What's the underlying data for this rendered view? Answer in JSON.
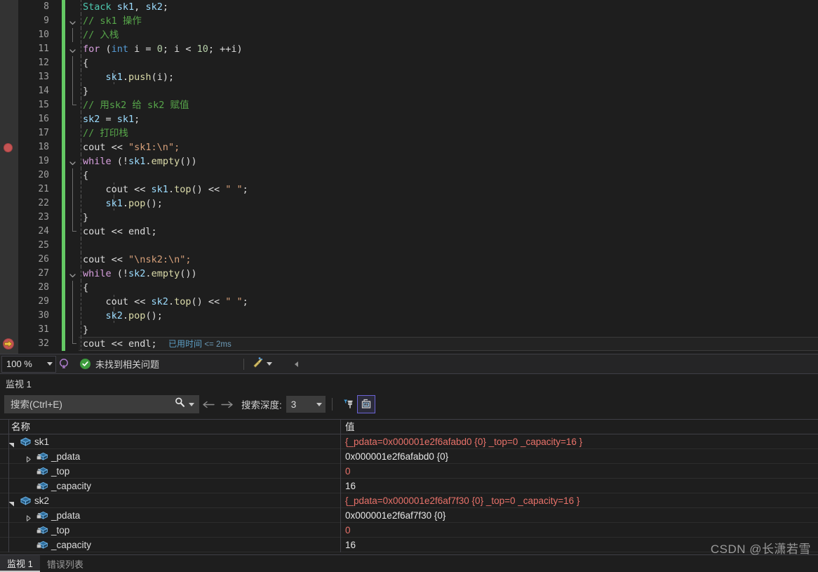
{
  "editor": {
    "lines": [
      {
        "no": "8",
        "indent": 0,
        "change": true,
        "outline": "none",
        "guides": [
          1
        ],
        "tokens": [
          {
            "t": "Stack",
            "c": "cls"
          },
          {
            "t": " ",
            "c": "pun"
          },
          {
            "t": "sk1",
            "c": "var"
          },
          {
            "t": ", ",
            "c": "pun"
          },
          {
            "t": "sk2",
            "c": "var"
          },
          {
            "t": ";",
            "c": "pun"
          }
        ]
      },
      {
        "no": "9",
        "indent": 0,
        "change": true,
        "outline": "chevron",
        "guides": [
          1
        ],
        "tokens": [
          {
            "t": "// sk1 操作",
            "c": "cmt"
          }
        ]
      },
      {
        "no": "10",
        "indent": 0,
        "change": true,
        "outline": "line",
        "guides": [
          1
        ],
        "tokens": [
          {
            "t": "// 入栈",
            "c": "cmt"
          }
        ]
      },
      {
        "no": "11",
        "indent": 0,
        "change": true,
        "outline": "chevron",
        "guides": [
          1
        ],
        "tokens": [
          {
            "t": "for",
            "c": "kw"
          },
          {
            "t": " (",
            "c": "pun"
          },
          {
            "t": "int",
            "c": "type"
          },
          {
            "t": " i = ",
            "c": "pun"
          },
          {
            "t": "0",
            "c": "num"
          },
          {
            "t": "; i < ",
            "c": "pun"
          },
          {
            "t": "10",
            "c": "num"
          },
          {
            "t": "; ++i)",
            "c": "pun"
          }
        ]
      },
      {
        "no": "12",
        "indent": 0,
        "change": true,
        "outline": "line",
        "guides": [
          1
        ],
        "tokens": [
          {
            "t": "{",
            "c": "pun"
          }
        ]
      },
      {
        "no": "13",
        "indent": 0,
        "change": true,
        "outline": "line",
        "guides": [
          1,
          2
        ],
        "tokens": [
          {
            "t": "    sk1",
            "c": "var"
          },
          {
            "t": ".",
            "c": "pun"
          },
          {
            "t": "push",
            "c": "fn"
          },
          {
            "t": "(i);",
            "c": "pun"
          }
        ]
      },
      {
        "no": "14",
        "indent": 0,
        "change": true,
        "outline": "line",
        "guides": [
          1
        ],
        "tokens": [
          {
            "t": "}",
            "c": "pun"
          }
        ]
      },
      {
        "no": "15",
        "indent": 0,
        "change": true,
        "outline": "foot",
        "guides": [
          1
        ],
        "tokens": [
          {
            "t": "// 用sk2 给 sk2 赋值",
            "c": "cmt"
          }
        ]
      },
      {
        "no": "16",
        "indent": 0,
        "change": true,
        "outline": "none",
        "guides": [
          1
        ],
        "tokens": [
          {
            "t": "sk2",
            "c": "var"
          },
          {
            "t": " = ",
            "c": "pun"
          },
          {
            "t": "sk1",
            "c": "var"
          },
          {
            "t": ";",
            "c": "pun"
          }
        ]
      },
      {
        "no": "17",
        "indent": 0,
        "change": true,
        "outline": "none",
        "guides": [
          1
        ],
        "tokens": [
          {
            "t": "// 打印栈",
            "c": "cmt"
          }
        ]
      },
      {
        "no": "18",
        "indent": 0,
        "change": true,
        "outline": "none",
        "guides": [
          1
        ],
        "breakpoint": true,
        "tokens": [
          {
            "t": "cout",
            "c": "pun"
          },
          {
            "t": " << ",
            "c": "pun"
          },
          {
            "t": "\"sk1:",
            "c": "str"
          },
          {
            "t": "\\n",
            "c": "str"
          },
          {
            "t": "\";",
            "c": "str"
          }
        ]
      },
      {
        "no": "19",
        "indent": 0,
        "change": true,
        "outline": "chevron",
        "guides": [
          1
        ],
        "tokens": [
          {
            "t": "while",
            "c": "kw"
          },
          {
            "t": " (!",
            "c": "pun"
          },
          {
            "t": "sk1",
            "c": "var"
          },
          {
            "t": ".",
            "c": "pun"
          },
          {
            "t": "empty",
            "c": "fn"
          },
          {
            "t": "())",
            "c": "pun"
          }
        ]
      },
      {
        "no": "20",
        "indent": 0,
        "change": true,
        "outline": "line",
        "guides": [
          1
        ],
        "tokens": [
          {
            "t": "{",
            "c": "pun"
          }
        ]
      },
      {
        "no": "21",
        "indent": 0,
        "change": true,
        "outline": "line",
        "guides": [
          1,
          2
        ],
        "tokens": [
          {
            "t": "    cout << ",
            "c": "pun"
          },
          {
            "t": "sk1",
            "c": "var"
          },
          {
            "t": ".",
            "c": "pun"
          },
          {
            "t": "top",
            "c": "fn"
          },
          {
            "t": "() << ",
            "c": "pun"
          },
          {
            "t": "\" \"",
            "c": "str"
          },
          {
            "t": ";",
            "c": "pun"
          }
        ]
      },
      {
        "no": "22",
        "indent": 0,
        "change": true,
        "outline": "line",
        "guides": [
          1,
          2
        ],
        "tokens": [
          {
            "t": "    sk1",
            "c": "var"
          },
          {
            "t": ".",
            "c": "pun"
          },
          {
            "t": "pop",
            "c": "fn"
          },
          {
            "t": "();",
            "c": "pun"
          }
        ]
      },
      {
        "no": "23",
        "indent": 0,
        "change": true,
        "outline": "line",
        "guides": [
          1
        ],
        "tokens": [
          {
            "t": "}",
            "c": "pun"
          }
        ]
      },
      {
        "no": "24",
        "indent": 0,
        "change": true,
        "outline": "foot",
        "guides": [
          1
        ],
        "tokens": [
          {
            "t": "cout << ",
            "c": "pun"
          },
          {
            "t": "endl",
            "c": "pun"
          },
          {
            "t": ";",
            "c": "pun"
          }
        ]
      },
      {
        "no": "25",
        "indent": 0,
        "change": true,
        "outline": "none",
        "guides": [
          1
        ],
        "tokens": []
      },
      {
        "no": "26",
        "indent": 0,
        "change": true,
        "outline": "none",
        "guides": [
          1
        ],
        "tokens": [
          {
            "t": "cout << ",
            "c": "pun"
          },
          {
            "t": "\"",
            "c": "str"
          },
          {
            "t": "\\n",
            "c": "str"
          },
          {
            "t": "sk2:",
            "c": "str"
          },
          {
            "t": "\\n",
            "c": "str"
          },
          {
            "t": "\";",
            "c": "str"
          }
        ]
      },
      {
        "no": "27",
        "indent": 0,
        "change": true,
        "outline": "chevron",
        "guides": [
          1
        ],
        "tokens": [
          {
            "t": "while",
            "c": "kw"
          },
          {
            "t": " (!",
            "c": "pun"
          },
          {
            "t": "sk2",
            "c": "var"
          },
          {
            "t": ".",
            "c": "pun"
          },
          {
            "t": "empty",
            "c": "fn"
          },
          {
            "t": "())",
            "c": "pun"
          }
        ]
      },
      {
        "no": "28",
        "indent": 0,
        "change": true,
        "outline": "line",
        "guides": [
          1
        ],
        "tokens": [
          {
            "t": "{",
            "c": "pun"
          }
        ]
      },
      {
        "no": "29",
        "indent": 0,
        "change": true,
        "outline": "line",
        "guides": [
          1,
          2
        ],
        "tokens": [
          {
            "t": "    cout << ",
            "c": "pun"
          },
          {
            "t": "sk2",
            "c": "var"
          },
          {
            "t": ".",
            "c": "pun"
          },
          {
            "t": "top",
            "c": "fn"
          },
          {
            "t": "() << ",
            "c": "pun"
          },
          {
            "t": "\" \"",
            "c": "str"
          },
          {
            "t": ";",
            "c": "pun"
          }
        ]
      },
      {
        "no": "30",
        "indent": 0,
        "change": true,
        "outline": "line",
        "guides": [
          1,
          2
        ],
        "tokens": [
          {
            "t": "    sk2",
            "c": "var"
          },
          {
            "t": ".",
            "c": "pun"
          },
          {
            "t": "pop",
            "c": "fn"
          },
          {
            "t": "();",
            "c": "pun"
          }
        ]
      },
      {
        "no": "31",
        "indent": 0,
        "change": true,
        "outline": "line",
        "guides": [
          1
        ],
        "tokens": [
          {
            "t": "}",
            "c": "pun"
          }
        ]
      },
      {
        "no": "32",
        "indent": 0,
        "change": true,
        "outline": "foot",
        "guides": [
          1
        ],
        "current": true,
        "tokens": [
          {
            "t": "cout << ",
            "c": "pun"
          },
          {
            "t": "endl",
            "c": "pun"
          },
          {
            "t": ";",
            "c": "pun"
          }
        ],
        "elapsed_label": "已用时间",
        "elapsed_value": "<= 2ms"
      }
    ]
  },
  "editor_status": {
    "zoom": "100 %",
    "zoom_caret": "chevron-down-icon",
    "pin_icon": "feedback-icon",
    "ok_mark": "✓",
    "message": "未找到相关问题",
    "brush_icon": "brush-icon",
    "brush_caret": "chevron-down-icon",
    "collapse_icon": "left-triangle-icon"
  },
  "watch": {
    "title": "监视 1",
    "search": {
      "placeholder": "搜索(Ctrl+E)",
      "value": "",
      "icon": "search-icon",
      "caret": "chevron-down-icon"
    },
    "nav_back": "←",
    "nav_forward": "→",
    "depth_label": "搜索深度:",
    "depth_value": "3",
    "depth_caret": "chevron-down-icon",
    "pin_button": "filter-pin-icon",
    "hex_button": "hex-display-icon",
    "columns": {
      "name": "名称",
      "value": "值"
    },
    "rows": [
      {
        "indent": 0,
        "twisty": "expanded",
        "icon": "object-icon",
        "name": "sk1",
        "value": "{_pdata=0x000001e2f6afabd0 {0} _top=0 _capacity=16 }",
        "changed": true
      },
      {
        "indent": 1,
        "twisty": "collapsed",
        "icon": "private-field-icon",
        "name": "_pdata",
        "value": "0x000001e2f6afabd0 {0}",
        "changed": false
      },
      {
        "indent": 1,
        "twisty": "none",
        "icon": "private-field-icon",
        "name": "_top",
        "value": "0",
        "changed": true
      },
      {
        "indent": 1,
        "twisty": "none",
        "icon": "private-field-icon",
        "name": "_capacity",
        "value": "16",
        "changed": false
      },
      {
        "indent": 0,
        "twisty": "expanded",
        "icon": "object-icon",
        "name": "sk2",
        "value": "{_pdata=0x000001e2f6af7f30 {0} _top=0 _capacity=16 }",
        "changed": true
      },
      {
        "indent": 1,
        "twisty": "collapsed",
        "icon": "private-field-icon",
        "name": "_pdata",
        "value": "0x000001e2f6af7f30 {0}",
        "changed": false
      },
      {
        "indent": 1,
        "twisty": "none",
        "icon": "private-field-icon",
        "name": "_top",
        "value": "0",
        "changed": true
      },
      {
        "indent": 1,
        "twisty": "none",
        "icon": "private-field-icon",
        "name": "_capacity",
        "value": "16",
        "changed": false
      }
    ]
  },
  "bottom_tabs": [
    {
      "label": "监视 1",
      "active": true
    },
    {
      "label": "错误列表",
      "active": false
    }
  ],
  "watermark": "CSDN @长潇若雪",
  "colors": {
    "editor_bg": "#1e1e1e",
    "gutter_bg": "#333333",
    "change_bar": "#64c864",
    "breakpoint": "#c45454",
    "exec_arrow": "#f5c242",
    "changed_value": "#e9726a",
    "comment": "#57a64a",
    "keyword": "#d8a0df",
    "string": "#d7a07a",
    "accent_border": "#6b63d4"
  }
}
